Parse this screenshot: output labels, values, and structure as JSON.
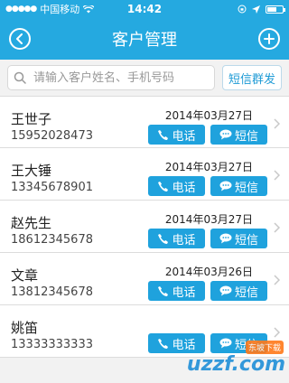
{
  "status_bar": {
    "carrier": "中国移动",
    "time": "14:42",
    "battery_level": 0.55
  },
  "nav": {
    "title": "客户管理",
    "back_icon": "chevron-left-icon",
    "add_icon": "plus-icon"
  },
  "search": {
    "placeholder": "请输入客户姓名、手机号码",
    "value": ""
  },
  "sms_group_label": "短信群发",
  "call_label": "电话",
  "sms_label": "短信",
  "contacts": [
    {
      "name": "王世子",
      "phone": "15952028473",
      "date": "2014年03月27日"
    },
    {
      "name": "王大锤",
      "phone": "13345678901",
      "date": "2014年03月27日"
    },
    {
      "name": "赵先生",
      "phone": "18612345678",
      "date": "2014年03月27日"
    },
    {
      "name": "文章",
      "phone": "13812345678",
      "date": "2014年03月26日"
    },
    {
      "name": "姚笛",
      "phone": "13333333333",
      "date": ""
    }
  ],
  "watermark": {
    "text": "uzzf.com",
    "badge": "东坡下载"
  },
  "colors": {
    "accent": "#25a9e0",
    "button": "#1fa2dd"
  }
}
